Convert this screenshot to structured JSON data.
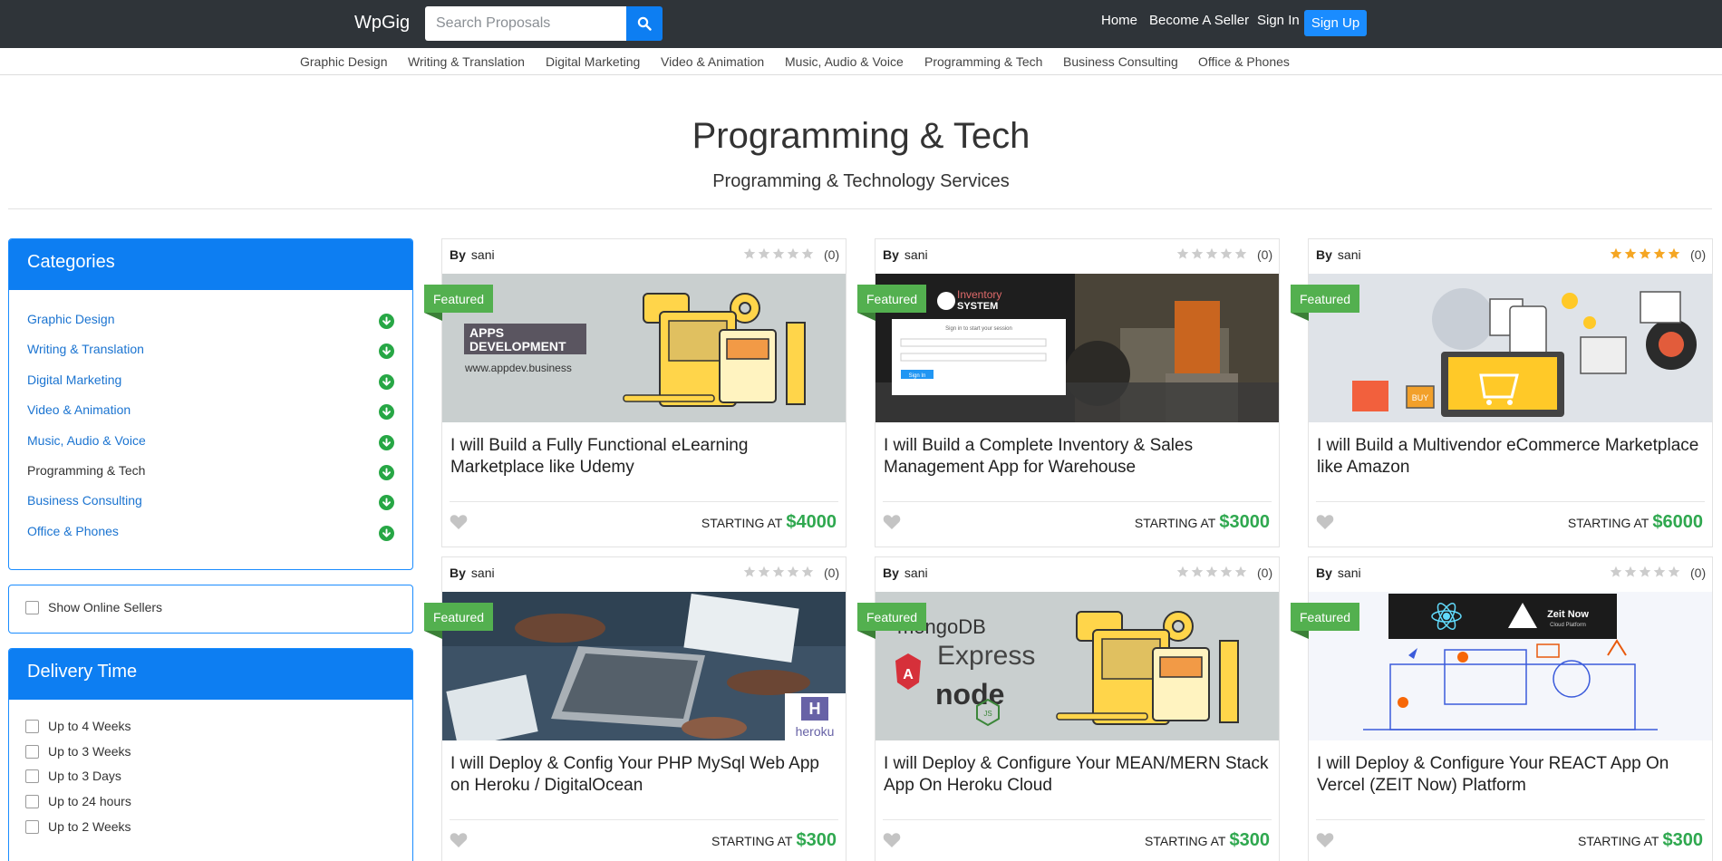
{
  "header": {
    "logo": "WpGig",
    "search_placeholder": "Search Proposals",
    "nav": [
      "Home",
      "Become A Seller",
      "Sign In"
    ],
    "signup": "Sign Up"
  },
  "category_bar": [
    "Graphic Design",
    "Writing & Translation",
    "Digital Marketing",
    "Video & Animation",
    "Music, Audio & Voice",
    "Programming & Tech",
    "Business Consulting",
    "Office & Phones"
  ],
  "hero": {
    "title": "Programming & Tech",
    "subtitle": "Programming & Technology Services"
  },
  "sidebar": {
    "categories_title": "Categories",
    "categories": [
      "Graphic Design",
      "Writing & Translation",
      "Digital Marketing",
      "Video & Animation",
      "Music, Audio & Voice",
      "Programming & Tech",
      "Business Consulting",
      "Office & Phones"
    ],
    "active_category": "Programming & Tech",
    "online_sellers": "Show Online Sellers",
    "delivery_title": "Delivery Time",
    "delivery_options": [
      "Up to 4 Weeks",
      "Up to 3 Weeks",
      "Up to 3 Days",
      "Up to 24 hours",
      "Up to 2 Weeks"
    ]
  },
  "colors": {
    "topbar": "#2f3439",
    "accent": "#0d7ef2",
    "price": "#2fa84f",
    "featured": "#53b04f",
    "star_filled": "#f5a623",
    "star_empty": "#cccccc"
  },
  "cards": [
    {
      "by_label": "By",
      "seller": "sani",
      "rating": 0,
      "rating_count": "(0)",
      "badge": "Featured",
      "title": "I will Build a Fully Functional eLearning Marketplace like Udemy",
      "price_label": "STARTING AT",
      "price": "$4000",
      "image": {
        "type": "apps",
        "line1": "APPS",
        "line2": "DEVELOPMENT",
        "url": "www.appdev.business"
      }
    },
    {
      "by_label": "By",
      "seller": "sani",
      "rating": 0,
      "rating_count": "(0)",
      "badge": "Featured",
      "title": "I will Build a Complete Inventory & Sales Management App for Warehouse",
      "price_label": "STARTING AT",
      "price": "$3000",
      "image": {
        "type": "inventory",
        "brand_top": "Inventory",
        "brand_bottom": "SYSTEM",
        "login_prompt": "Sign in to start your session",
        "button": "Sign In"
      }
    },
    {
      "by_label": "By",
      "seller": "sani",
      "rating": 5,
      "rating_count": "(0)",
      "badge": "Featured",
      "title": "I will Build a Multivendor eCommerce Marketplace like Amazon",
      "price_label": "STARTING AT",
      "price": "$6000",
      "image": {
        "type": "ecommerce",
        "buy": "BUY"
      }
    },
    {
      "by_label": "By",
      "seller": "sani",
      "rating": 0,
      "rating_count": "(0)",
      "badge": "Featured",
      "title": "I will Deploy & Config Your PHP MySql Web App on Heroku / DigitalOcean",
      "price_label": "STARTING AT",
      "price": "$300",
      "image": {
        "type": "heroku",
        "brand": "heroku"
      }
    },
    {
      "by_label": "By",
      "seller": "sani",
      "rating": 0,
      "rating_count": "(0)",
      "badge": "Featured",
      "title": "I will Deploy & Configure Your MEAN/MERN Stack App On Heroku Cloud",
      "price_label": "STARTING AT",
      "price": "$300",
      "image": {
        "type": "mean",
        "t1": "mongoDB",
        "t2": "Express",
        "t3": "node",
        "t4": "JS"
      }
    },
    {
      "by_label": "By",
      "seller": "sani",
      "rating": 0,
      "rating_count": "(0)",
      "badge": "Featured",
      "title": "I will Deploy & Configure Your REACT App On Vercel (ZEIT Now) Platform",
      "price_label": "STARTING AT",
      "price": "$300",
      "image": {
        "type": "vercel",
        "brand": "Zeit Now",
        "tagline": "Cloud Platform"
      }
    }
  ]
}
